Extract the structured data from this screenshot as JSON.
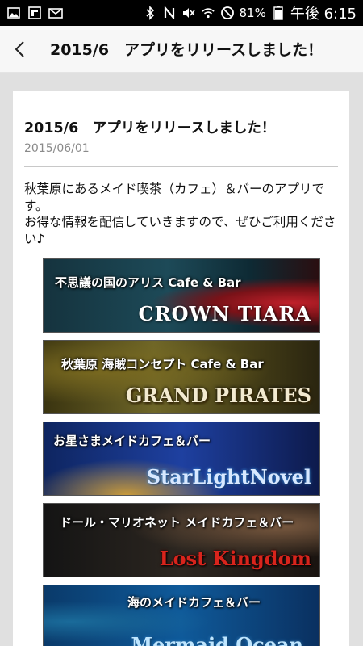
{
  "status_bar": {
    "battery": "81%",
    "time": "午後 6:15"
  },
  "header": {
    "title": "2015/6　アプリをリリースしました！"
  },
  "article": {
    "title": "2015/6　アプリをリリースしました！",
    "date": "2015/06/01",
    "body_line1": "秋葉原にあるメイド喫茶（カフェ）＆バーのアプリです。",
    "body_line2": "お得な情報を配信していきますので、ぜひご利用ください♪"
  },
  "banners": [
    {
      "subtitle": "不思議の国のアリス Cafe & Bar",
      "name": "CROWN TIARA"
    },
    {
      "subtitle": "秋葉原 海賊コンセプト Cafe & Bar",
      "name": "GRAND PIRATES"
    },
    {
      "subtitle": "お星さまメイドカフェ＆バー",
      "name": "StarLightNovel"
    },
    {
      "subtitle": "ドール・マリオネット メイドカフェ＆バー",
      "name": "Lost Kingdom"
    },
    {
      "subtitle": "海のメイドカフェ＆バー",
      "name": "Mermaid Ocean"
    }
  ]
}
